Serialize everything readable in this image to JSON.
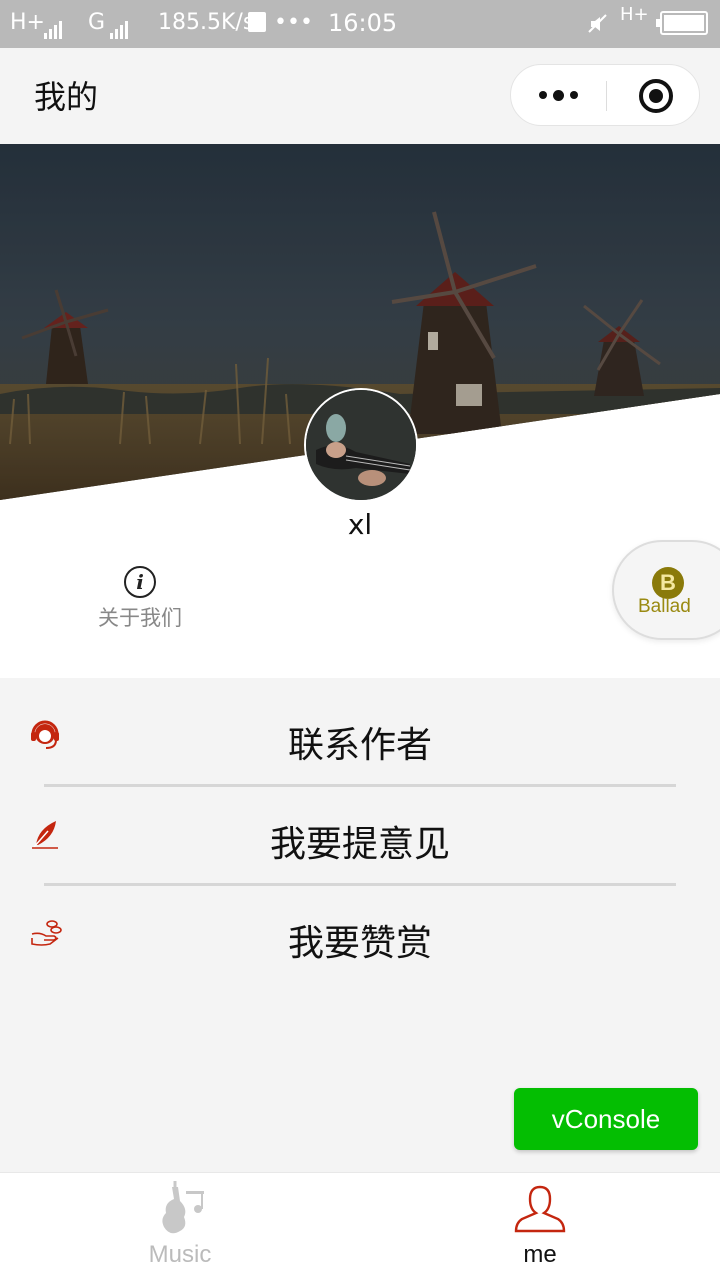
{
  "status_bar": {
    "network1": "H+",
    "network2": "G",
    "speed": "185.5K/s",
    "dots": "•••",
    "time": "16:05",
    "network3": "H+"
  },
  "nav": {
    "title": "我的"
  },
  "profile": {
    "username": "xl",
    "about_label": "关于我们",
    "about_icon": "i"
  },
  "float_button": {
    "badge_letter": "B",
    "brand": "Ballad"
  },
  "menu": [
    {
      "label": "联系作者",
      "icon": "customer-service-icon"
    },
    {
      "label": "我要提意见",
      "icon": "feather-pen-icon"
    },
    {
      "label": "我要赞赏",
      "icon": "hand-coins-icon"
    }
  ],
  "vconsole": {
    "label": "vConsole"
  },
  "tabs": [
    {
      "label": "Music",
      "icon": "violin-music-icon",
      "active": false
    },
    {
      "label": "me",
      "icon": "user-icon",
      "active": true
    }
  ],
  "colors": {
    "accent_red": "#c4260f",
    "vconsole_green": "#04be02",
    "ballad_gold": "#8a7a0a"
  }
}
